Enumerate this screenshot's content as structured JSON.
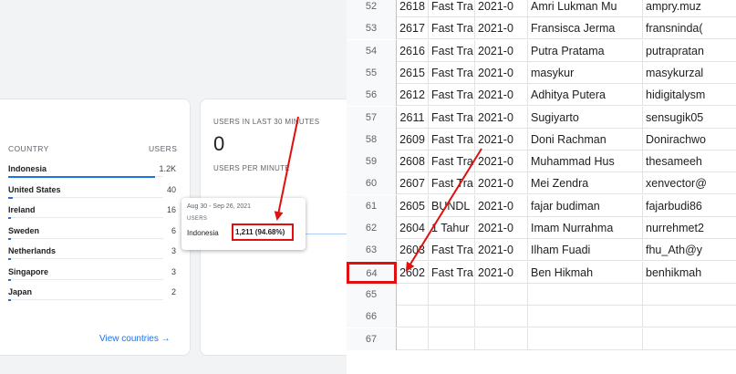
{
  "analytics": {
    "country_card": {
      "col_country": "COUNTRY",
      "col_users": "USERS",
      "rows": [
        {
          "country": "Indonesia",
          "users": "1.2K",
          "share": 0.9468
        },
        {
          "country": "United States",
          "users": "40",
          "share": 0.031
        },
        {
          "country": "Ireland",
          "users": "16",
          "share": 0.013
        },
        {
          "country": "Sweden",
          "users": "6",
          "share": 0.005
        },
        {
          "country": "Netherlands",
          "users": "3",
          "share": 0.0025
        },
        {
          "country": "Singapore",
          "users": "3",
          "share": 0.0025
        },
        {
          "country": "Japan",
          "users": "2",
          "share": 0.0016
        }
      ],
      "view_link": "View countries",
      "view_arrow": "→"
    },
    "realtime_card": {
      "title": "USERS IN LAST 30 MINUTES",
      "count": "0",
      "subtitle": "USERS PER MINUTE"
    },
    "tooltip": {
      "date_range": "Aug 30 - Sep 26, 2021",
      "label": "USERS",
      "country": "Indonesia",
      "value": "1,211 (94.68%)"
    }
  },
  "sheet": {
    "rows": [
      {
        "n": "52",
        "a": "2618",
        "b": "Fast Tra",
        "c": "2021-0",
        "d": "Amri Lukman Mu",
        "e": "ampry.muz"
      },
      {
        "n": "53",
        "a": "2617",
        "b": "Fast Tra",
        "c": "2021-0",
        "d": "Fransisca Jerma",
        "e": "fransninda("
      },
      {
        "n": "54",
        "a": "2616",
        "b": "Fast Tra",
        "c": "2021-0",
        "d": "Putra Pratama",
        "e": "putrapratan"
      },
      {
        "n": "55",
        "a": "2615",
        "b": "Fast Tra",
        "c": "2021-0",
        "d": "masykur",
        "e": "masykurzal"
      },
      {
        "n": "56",
        "a": "2612",
        "b": "Fast Tra",
        "c": "2021-0",
        "d": "Adhitya Putera",
        "e": "hidigitalysm"
      },
      {
        "n": "57",
        "a": "2611",
        "b": "Fast Tra",
        "c": "2021-0",
        "d": "Sugiyarto",
        "e": "sensugik05"
      },
      {
        "n": "58",
        "a": "2609",
        "b": "Fast Tra",
        "c": "2021-0",
        "d": "Doni Rachman",
        "e": "Donirachwo"
      },
      {
        "n": "59",
        "a": "2608",
        "b": "Fast Tra",
        "c": "2021-0",
        "d": "Muhammad Hus",
        "e": "thesameeh"
      },
      {
        "n": "60",
        "a": "2607",
        "b": "Fast Tra",
        "c": "2021-0",
        "d": "Mei Zendra",
        "e": "xenvector@"
      },
      {
        "n": "61",
        "a": "2605",
        "b": "BUNDL",
        "c": "2021-0",
        "d": "fajar budiman",
        "e": "fajarbudi86"
      },
      {
        "n": "62",
        "a": "2604",
        "b": "1 Tahur",
        "c": "2021-0",
        "d": "Imam Nurrahma",
        "e": "nurrehmet2"
      },
      {
        "n": "63",
        "a": "2603",
        "b": "Fast Tra",
        "c": "2021-0",
        "d": "Ilham Fuadi",
        "e": "fhu_Ath@y"
      },
      {
        "n": "64",
        "a": "2602",
        "b": "Fast Tra",
        "c": "2021-0",
        "d": "Ben Hikmah",
        "e": "benhikmah"
      },
      {
        "n": "65",
        "a": "",
        "b": "",
        "c": "",
        "d": "",
        "e": ""
      },
      {
        "n": "66",
        "a": "",
        "b": "",
        "c": "",
        "d": "",
        "e": ""
      },
      {
        "n": "67",
        "a": "",
        "b": "",
        "c": "",
        "d": "",
        "e": ""
      }
    ],
    "highlighted_row": "64"
  },
  "annotation_color": "#e01010"
}
